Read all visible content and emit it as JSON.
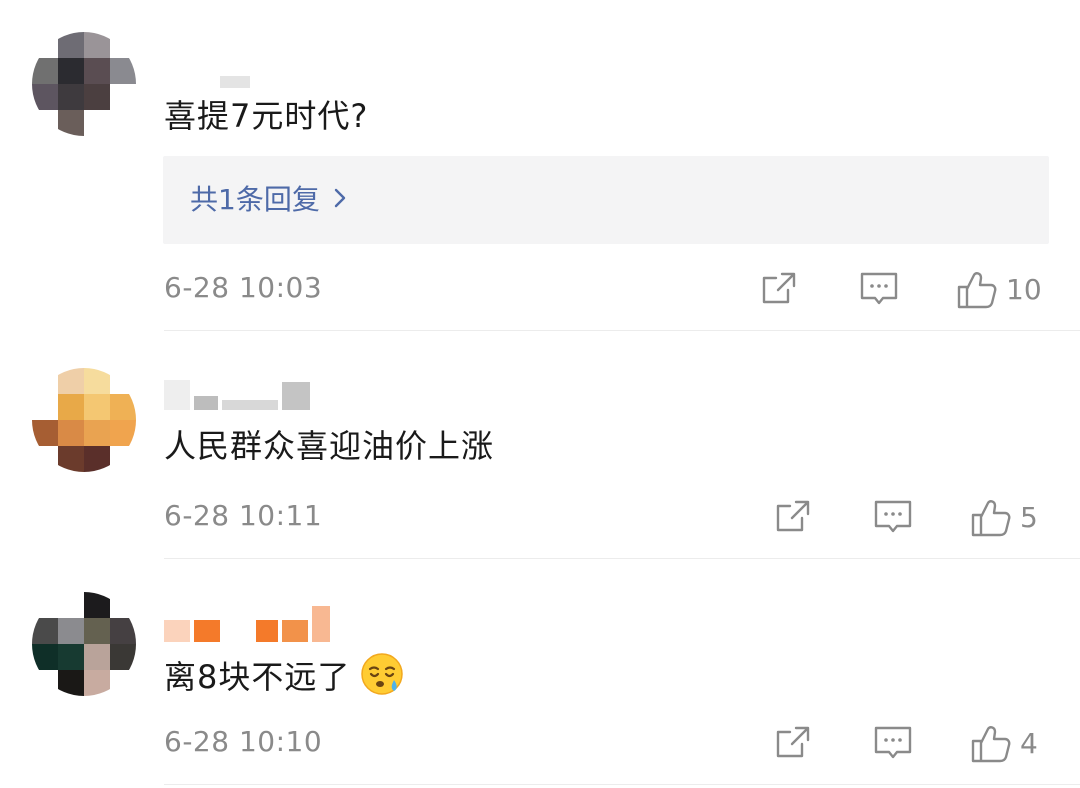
{
  "comments": [
    {
      "text": "喜提7元时代?",
      "reply_link": "共1条回复",
      "time": "6-28 10:03",
      "like_count": "10",
      "avatar_colors": [
        "#ffffff",
        "#6e6c74",
        "#9a9498",
        "#ffffff",
        "#707070",
        "#2b2b30",
        "#5a4d52",
        "#8a8a90",
        "#5d5560",
        "#3e3a3e",
        "#4b3f40",
        "#ffffff",
        "#ffffff",
        "#6a5e5a",
        "#ffffff",
        "#ffffff"
      ],
      "username_colors": [
        "#e6e6e6",
        "#bdbdbd"
      ]
    },
    {
      "text": "人民群众喜迎油价上涨",
      "time": "6-28 10:11",
      "like_count": "5",
      "avatar_colors": [
        "#ffffff",
        "#efcfa8",
        "#f6dc9d",
        "#ffffff",
        "#ffffff",
        "#e8a948",
        "#f4c772",
        "#efb155",
        "#a65e33",
        "#d98a46",
        "#e9a351",
        "#f0a44e",
        "#ffffff",
        "#6b3b2c",
        "#5a2f2a",
        "#ffffff"
      ],
      "username_colors": [
        "#efefef",
        "#c9c9c9",
        "#8d8d8d",
        "#bdbdbd"
      ]
    },
    {
      "text": "离8块不远了",
      "emoji": "sleepy-face",
      "time": "6-28 10:10",
      "like_count": "4",
      "avatar_colors": [
        "#ffffff",
        "#ffffff",
        "#1c1b1d",
        "#ffffff",
        "#4a4a4a",
        "#8b8b8f",
        "#646150",
        "#454042",
        "#0f2f28",
        "#173a31",
        "#b9a39a",
        "#3a3835",
        "#ffffff",
        "#1a1816",
        "#c8aba0",
        "#ffffff"
      ],
      "username_colors": [
        "#f8c8ad",
        "#f47a2a",
        "#f2924a",
        "#f6b28a"
      ]
    }
  ],
  "icons": {
    "share": "share-icon",
    "comment": "comment-icon",
    "like": "thumbs-up-icon",
    "chevron": "chevron-right-icon"
  },
  "colors": {
    "link": "#4e6aa8",
    "meta": "#8a8a8a",
    "reply_bg": "#f4f4f5",
    "text": "#1a1a1a"
  }
}
